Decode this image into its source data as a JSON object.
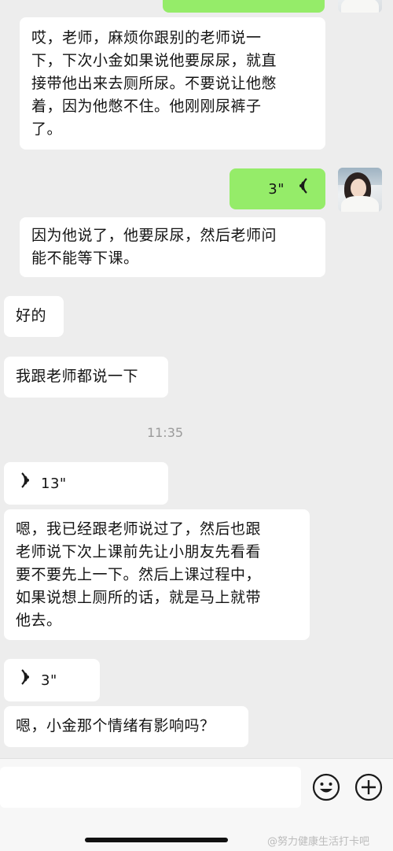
{
  "messages": [
    {
      "from": "other",
      "type": "text",
      "text_lines": [
        "哎，老师，麻烦你跟别的老师说一",
        "下，下次小金如果说他要尿尿，就直",
        "接带他出来去厕所尿。不要说让他憋",
        "着，因为他憋不住。他刚刚尿裤子",
        "了。"
      ]
    },
    {
      "from": "me",
      "type": "voice",
      "duration": "3\""
    },
    {
      "from": "other",
      "type": "text",
      "text_lines": [
        "因为他说了，他要尿尿，然后老师问",
        "能不能等下课。"
      ]
    },
    {
      "from": "other",
      "type": "text",
      "text_lines": [
        "好的"
      ]
    },
    {
      "from": "other",
      "type": "text",
      "text_lines": [
        "我跟老师都说一下"
      ]
    },
    {
      "type": "time",
      "text": "11:35"
    },
    {
      "from": "other",
      "type": "voice",
      "duration": "13\""
    },
    {
      "from": "other",
      "type": "text",
      "text_lines": [
        "嗯，我已经跟老师说过了，然后也跟",
        "老师说下次上课前先让小朋友先看看",
        "要不要先上一下。然后上课过程中，",
        "如果说想上厕所的话，就是马上就带",
        "他去。"
      ]
    },
    {
      "from": "other",
      "type": "voice",
      "duration": "3\""
    },
    {
      "from": "other",
      "type": "text",
      "text_lines": [
        "嗯，小金那个情绪有影响吗？"
      ]
    }
  ],
  "input_bar": {
    "emoji_icon": "emoji-smile-icon",
    "add_icon": "plus-circle-icon"
  },
  "watermark": "@努力健康生活打卡吧",
  "colors": {
    "background": "#ededed",
    "my_bubble": "#95ec69",
    "other_bubble": "#ffffff",
    "time_text": "#9a9a9a"
  }
}
